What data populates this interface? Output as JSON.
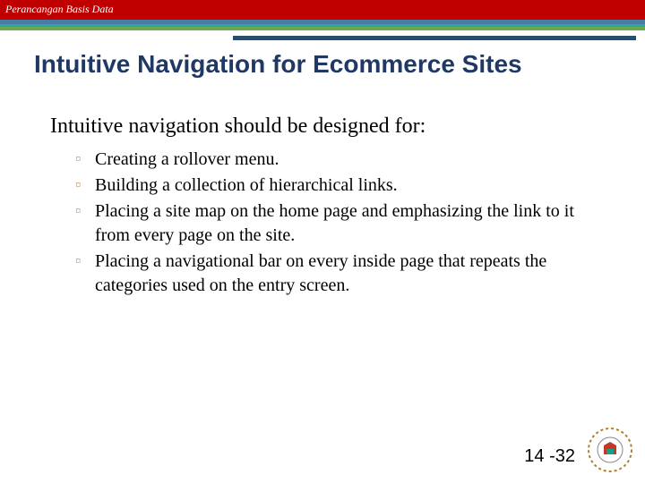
{
  "header": {
    "course_label": "Perancangan Basis Data"
  },
  "slide": {
    "title": "Intuitive Navigation for Ecommerce Sites",
    "lead": "Intuitive navigation should be designed for:",
    "bullets": [
      "Creating a rollover menu.",
      "Building a collection of hierarchical links.",
      "Placing a site map on the home page and emphasizing the link to it from every page on the site.",
      "Placing a navigational bar on every inside page that repeats the categories used on the entry screen."
    ],
    "page_number": "14 -32"
  }
}
